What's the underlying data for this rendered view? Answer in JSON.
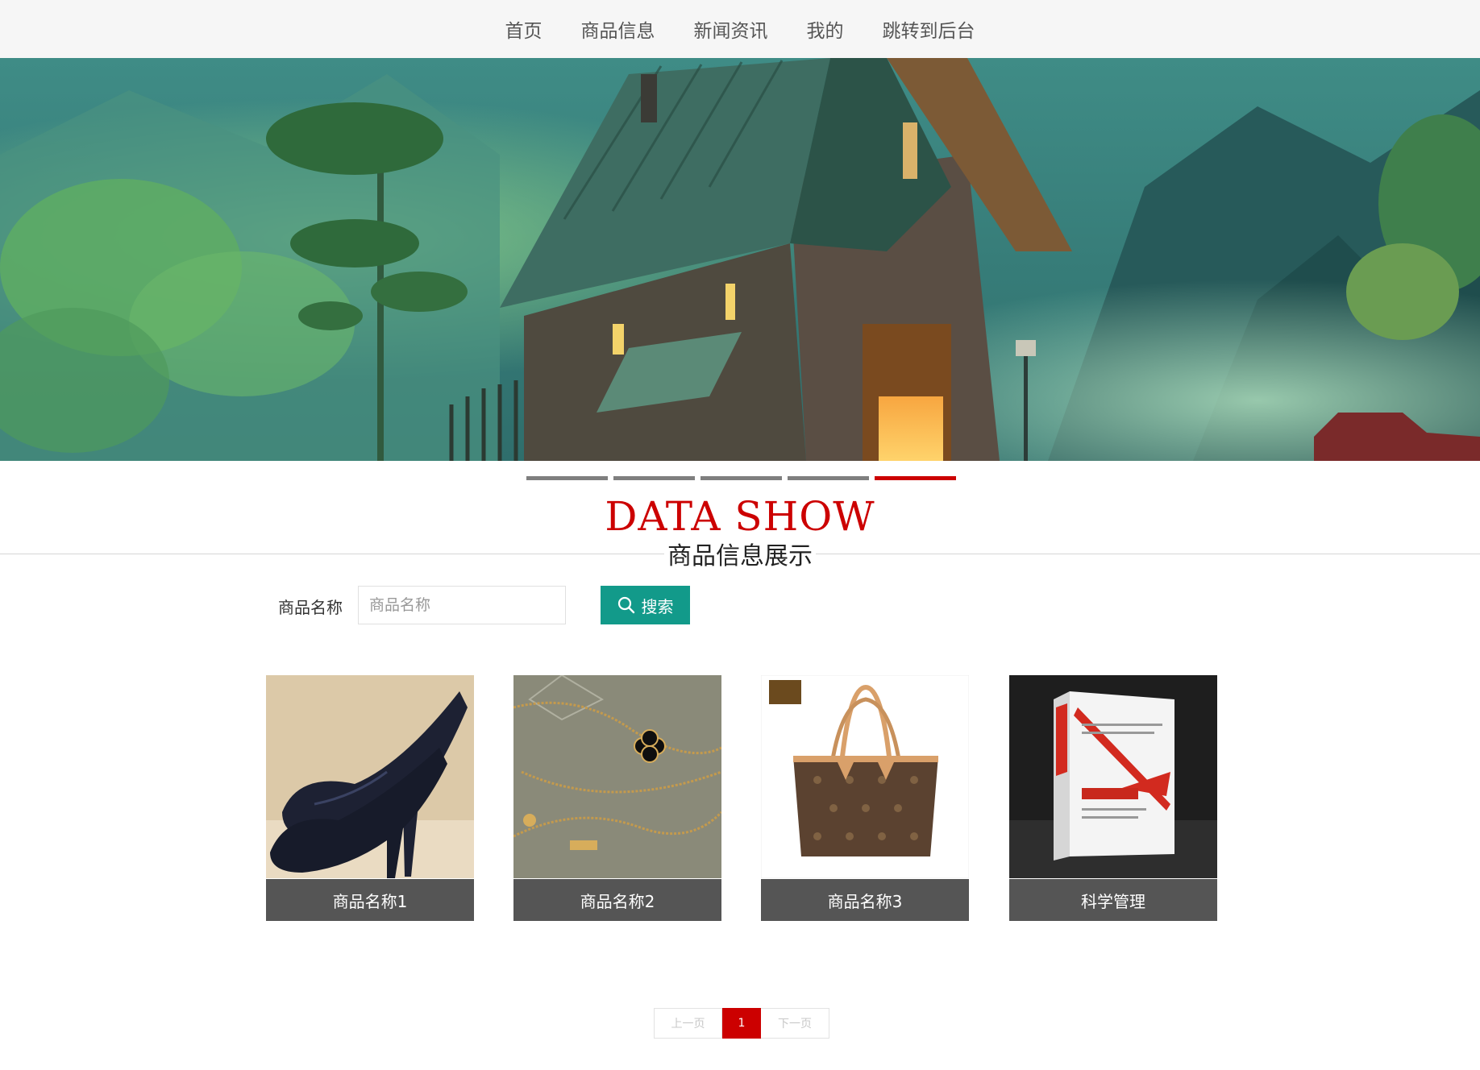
{
  "nav": {
    "items": [
      {
        "label": "首页"
      },
      {
        "label": "商品信息"
      },
      {
        "label": "新闻资讯"
      },
      {
        "label": "我的"
      },
      {
        "label": "跳转到后台"
      }
    ]
  },
  "carousel": {
    "slide_count": 5,
    "active_index": 4
  },
  "section": {
    "title_en": "DATA SHOW",
    "title_zh": "商品信息展示"
  },
  "search": {
    "label": "商品名称",
    "placeholder": "商品名称",
    "value": "",
    "button_label": "搜索"
  },
  "products": [
    {
      "name": "商品名称1",
      "image": "black-pumps-shoes"
    },
    {
      "name": "商品名称2",
      "image": "gold-clover-necklace"
    },
    {
      "name": "商品名称3",
      "image": "monogram-tote-bag"
    },
    {
      "name": "科学管理",
      "image": "book-cover"
    }
  ],
  "pagination": {
    "prev_label": "上一页",
    "current_page": "1",
    "next_label": "下一页"
  },
  "colors": {
    "accent_red": "#cc0000",
    "search_button": "#129a8a",
    "caption_bg": "#555555",
    "nav_bg": "#f6f6f6"
  }
}
